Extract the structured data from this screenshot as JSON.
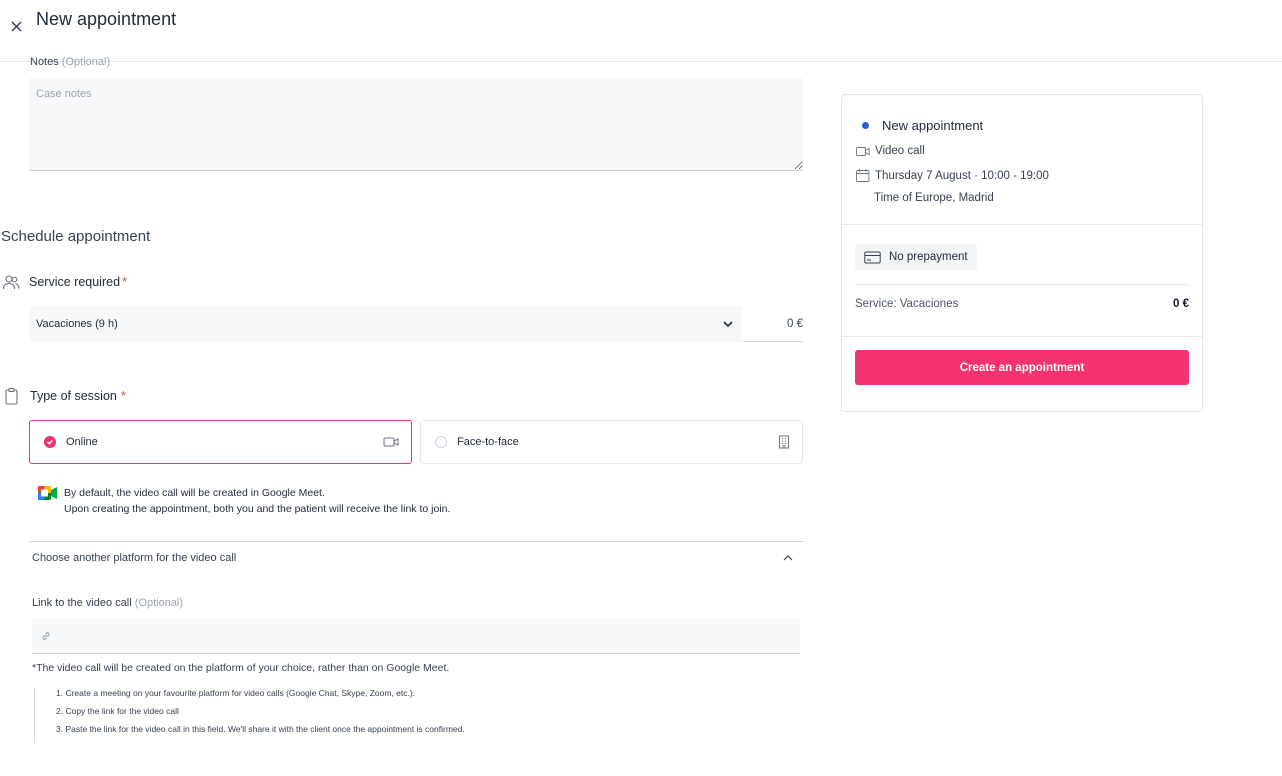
{
  "header": {
    "title": "New appointment",
    "close_icon": "close-icon"
  },
  "notes": {
    "label": "Notes",
    "optional": "(Optional)",
    "placeholder": "Case notes"
  },
  "schedule": {
    "section_title": "Schedule appointment"
  },
  "service": {
    "label": "Service required",
    "required_mark": "*",
    "selected": "Vacaciones (9 h)",
    "price": "0 €"
  },
  "session": {
    "label": "Type of session",
    "required_mark": "*",
    "options": [
      {
        "label": "Online",
        "selected": true,
        "icon": "video-camera-icon"
      },
      {
        "label": "Face-to-face",
        "selected": false,
        "icon": "building-icon"
      }
    ]
  },
  "meet_info": {
    "line1": "By default, the video call will be created in Google Meet.",
    "line2": "Upon creating the appointment, both you and the patient will receive the link to join."
  },
  "platform": {
    "toggle_label": "Choose another platform for the video call",
    "link_label": "Link to the video call",
    "link_optional": "(Optional)",
    "note": "*The video call will be created on the platform of your choice, rather than on Google Meet.",
    "steps": [
      "1. Create a meeting on your favourite platform for video calls (Google Chat, Skype, Zoom, etc.).",
      "2. Copy the link for the video call",
      "3. Paste the link for the video call in this field. We'll share it with the client once the appointment is confirmed."
    ]
  },
  "summary": {
    "title": "New appointment",
    "type": "Video call",
    "date": "Thursday 7 August · 10:00 - 19:00",
    "timezone": "Time of Europe, Madrid",
    "prepayment": "No prepayment",
    "service_label": "Service: Vacaciones",
    "service_price": "0 €",
    "create_button": "Create an appointment"
  },
  "colors": {
    "accent": "#f4326f",
    "selected_border": "#e8336e",
    "dot": "#2d5bd6"
  }
}
